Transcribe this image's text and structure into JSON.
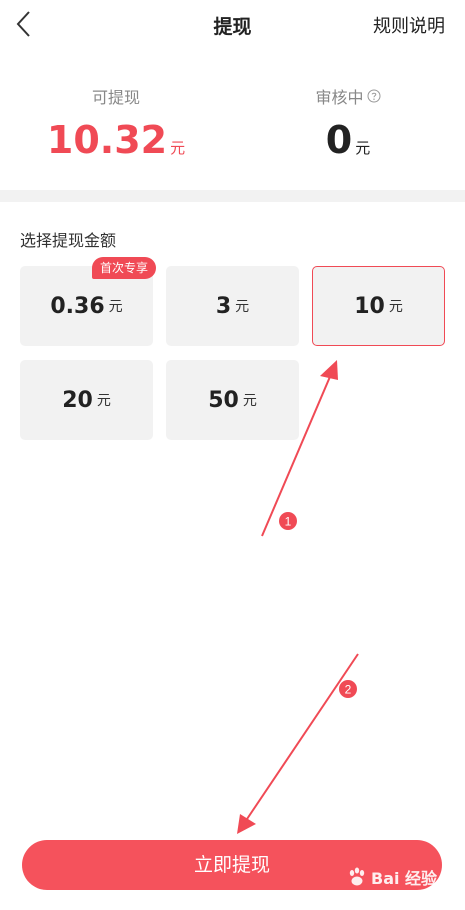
{
  "nav": {
    "title": "提现",
    "rules_label": "规则说明"
  },
  "balance": {
    "available_label": "可提现",
    "available_value": "10.32",
    "available_unit": "元",
    "pending_label": "审核中",
    "pending_value": "0",
    "pending_unit": "元"
  },
  "amounts": {
    "section_label": "选择提现金额",
    "badge": "首次专享",
    "unit": "元",
    "options": [
      "0.36",
      "3",
      "10",
      "20",
      "50"
    ],
    "selected": "10"
  },
  "annotations": {
    "step1": "1",
    "step2": "2"
  },
  "submit_label": "立即提现",
  "watermark": {
    "text": "Bai  经验"
  },
  "colors": {
    "accent": "#f04a55",
    "button": "#f5525c"
  }
}
